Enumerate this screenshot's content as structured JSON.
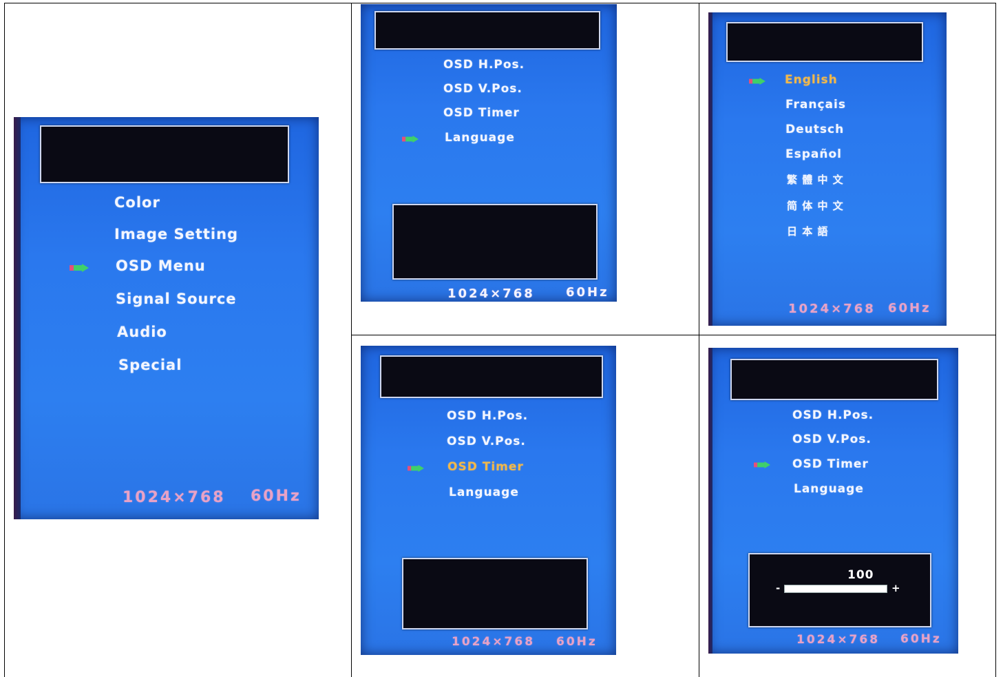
{
  "panel_main": {
    "items": [
      "Color",
      "Image  Setting",
      "OSD  Menu",
      "Signal  Source",
      "Audio",
      "Special"
    ],
    "selected_index": 2,
    "resolution": "1024×768",
    "refresh": "60Hz"
  },
  "panel_osd_lang": {
    "items": [
      "OSD  H.Pos.",
      "OSD  V.Pos.",
      "OSD  Timer",
      "Language"
    ],
    "selected_index": 3,
    "resolution": "1024×768",
    "refresh": "60Hz"
  },
  "panel_languages": {
    "items": [
      "English",
      "Français",
      "Deutsch",
      "Español",
      "繁 體 中 文",
      "简 体 中 文",
      "日 本 語"
    ],
    "selected_index": 0,
    "resolution": "1024×768",
    "refresh": "60Hz"
  },
  "panel_osd_timer": {
    "items": [
      "OSD  H.Pos.",
      "OSD  V.Pos.",
      "OSD  Timer",
      "Language"
    ],
    "selected_index": 2,
    "resolution": "1024×768",
    "refresh": "60Hz"
  },
  "panel_osd_timer_slider": {
    "items": [
      "OSD  H.Pos.",
      "OSD  V.Pos.",
      "OSD  Timer",
      "Language"
    ],
    "selected_index": 2,
    "slider_value": "100",
    "slider_minus": "-",
    "slider_plus": "+",
    "slider_fraction": 1.0,
    "resolution": "1024×768",
    "refresh": "60Hz"
  },
  "colors": {
    "screen_blue": "#2a78ee",
    "highlight": "#f2b84a",
    "resolution_pink": "#e8a2c6"
  },
  "icons": {
    "selection_pointer": "arrow-pointer-icon"
  }
}
